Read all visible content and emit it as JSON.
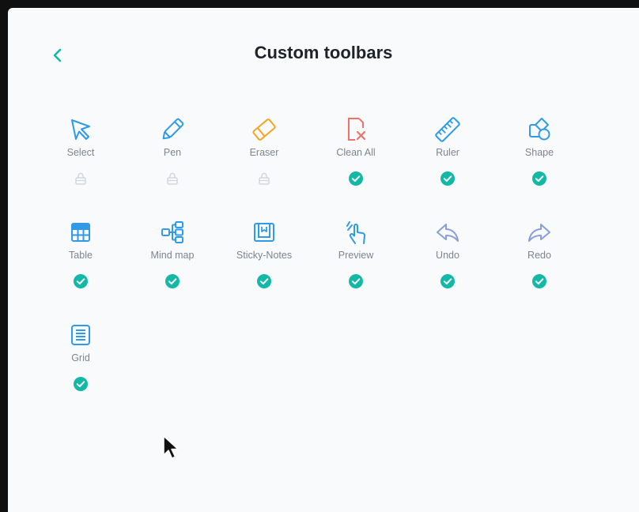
{
  "header": {
    "title": "Custom toolbars",
    "back_icon": "chevron-left-icon"
  },
  "colors": {
    "accent": "#14b8a6",
    "icon_blue": "#2f9be8",
    "eraser": "#f5a524",
    "clean_all": "#f0706a",
    "undo_redo": "#8a9fd8",
    "lock": "#cfd6dd",
    "background": "#f8fafb"
  },
  "tools": [
    {
      "label": "Select",
      "icon": "select-arrow-icon",
      "status": "locked"
    },
    {
      "label": "Pen",
      "icon": "pen-icon",
      "status": "locked"
    },
    {
      "label": "Eraser",
      "icon": "eraser-icon",
      "status": "locked"
    },
    {
      "label": "Clean All",
      "icon": "clean-all-icon",
      "status": "checked"
    },
    {
      "label": "Ruler",
      "icon": "ruler-icon",
      "status": "checked"
    },
    {
      "label": "Shape",
      "icon": "shape-icon",
      "status": "checked"
    },
    {
      "label": "Table",
      "icon": "table-icon",
      "status": "checked"
    },
    {
      "label": "Mind map",
      "icon": "mind-map-icon",
      "status": "checked"
    },
    {
      "label": "Sticky-Notes",
      "icon": "sticky-notes-icon",
      "status": "checked"
    },
    {
      "label": "Preview",
      "icon": "preview-icon",
      "status": "checked"
    },
    {
      "label": "Undo",
      "icon": "undo-icon",
      "status": "checked"
    },
    {
      "label": "Redo",
      "icon": "redo-icon",
      "status": "checked"
    },
    {
      "label": "Grid",
      "icon": "grid-icon",
      "status": "checked"
    }
  ]
}
